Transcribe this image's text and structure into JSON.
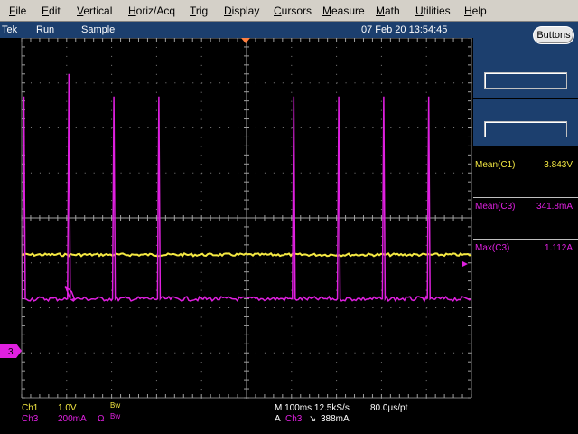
{
  "menu": [
    "File",
    "Edit",
    "Vertical",
    "Horiz/Acq",
    "Trig",
    "Display",
    "Cursors",
    "Measure",
    "Math",
    "Utilities",
    "Help"
  ],
  "status": {
    "brand": "Tek",
    "state": "Run",
    "mode": "Sample",
    "datetime": "07 Feb 20 13:54:45"
  },
  "buttons_label": "Buttons",
  "measurements": [
    {
      "label": "Mean(C1)",
      "value": "3.843V",
      "color": "#f4e842"
    },
    {
      "label": "Mean(C3)",
      "value": "341.8mA",
      "color": "#e020e0"
    },
    {
      "label": "Max(C3)",
      "value": "1.112A",
      "color": "#e020e0"
    }
  ],
  "channels": [
    {
      "name": "Ch1",
      "scale": "1.0V",
      "extra": "",
      "bw": "Bw",
      "color": "#f4e842"
    },
    {
      "name": "Ch3",
      "scale": "200mA",
      "extra": "Ω",
      "bw": "Bw",
      "color": "#e020e0"
    }
  ],
  "timebase": {
    "line1": "M 100ms 12.5kS/s",
    "rate": "80.0µs/pt",
    "trig_prefix": "A",
    "trig_ch": "Ch3",
    "trig_symbol": "↘",
    "trig_level": "388mA"
  },
  "markers": {
    "ch3_marker": "3"
  },
  "colors": {
    "ch1": "#f4e842",
    "ch3": "#e020e0",
    "grid": "#808080",
    "statusbar": "#1c3f6e"
  },
  "chart_data": {
    "type": "line",
    "x_unit": "divisions",
    "series": [
      {
        "name": "Ch1",
        "flat_level_div": -0.82
      },
      {
        "name": "Ch3",
        "baseline_div": -1.8,
        "pulses": [
          {
            "x_div": -4.95,
            "peak_div": 2.7
          },
          {
            "x_div": -3.95,
            "peak_div": 3.2,
            "secondary": true
          },
          {
            "x_div": -2.95,
            "peak_div": 2.7
          },
          {
            "x_div": -1.95,
            "peak_div": 2.7
          },
          {
            "x_div": 1.05,
            "peak_div": 2.7
          },
          {
            "x_div": 2.05,
            "peak_div": 2.7
          },
          {
            "x_div": 3.05,
            "peak_div": 2.7
          },
          {
            "x_div": 4.05,
            "peak_div": 2.7
          }
        ]
      }
    ],
    "xlim": [
      -5,
      5
    ],
    "ylim": [
      -4,
      4
    ]
  }
}
